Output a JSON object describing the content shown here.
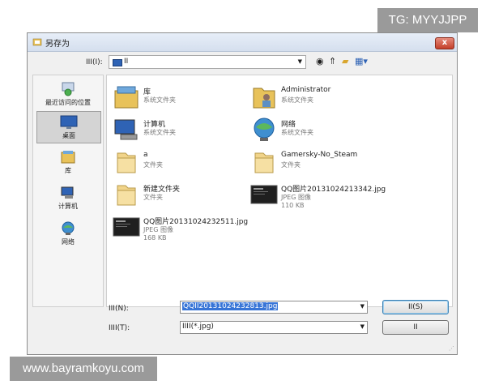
{
  "watermarks": {
    "top": "TG: MYYJJPP",
    "bottom": "www.bayramkoyu.com"
  },
  "window": {
    "title": "另存为",
    "close_glyph": "x"
  },
  "address": {
    "label": "III(I):",
    "value": "II"
  },
  "sidebar": {
    "items": [
      {
        "label": "最近访问的位置",
        "icon": "recent-places-icon"
      },
      {
        "label": "桌面",
        "icon": "desktop-icon",
        "selected": true
      },
      {
        "label": "库",
        "icon": "libraries-icon"
      },
      {
        "label": "计算机",
        "icon": "computer-icon"
      },
      {
        "label": "网络",
        "icon": "network-icon"
      }
    ]
  },
  "files": [
    {
      "name": "库",
      "type": "系统文件夹",
      "icon": "libraries-icon"
    },
    {
      "name": "Administrator",
      "type": "系统文件夹",
      "icon": "user-folder-icon"
    },
    {
      "name": "计算机",
      "type": "系统文件夹",
      "icon": "computer-icon"
    },
    {
      "name": "网络",
      "type": "系统文件夹",
      "icon": "network-icon"
    },
    {
      "name": "a",
      "type": "文件夹",
      "icon": "folder-icon"
    },
    {
      "name": "Gamersky-No_Steam",
      "type": "文件夹",
      "icon": "folder-icon"
    },
    {
      "name": "新建文件夹",
      "type": "文件夹",
      "icon": "folder-icon"
    },
    {
      "name": "QQ图片20131024213342.jpg",
      "type": "JPEG 图像",
      "size": "110 KB",
      "icon": "image-thumbnail-icon"
    },
    {
      "name": "QQ图片20131024232511.jpg",
      "type": "JPEG 图像",
      "size": "168 KB",
      "icon": "image-thumbnail-icon"
    }
  ],
  "filename": {
    "label": "III(N):",
    "value": "QQII20131024232813.jpg"
  },
  "filetype": {
    "label": "IIII(T):",
    "value": "IIII(*.jpg)"
  },
  "buttons": {
    "save": "II(S)",
    "cancel": "II"
  },
  "colors": {
    "accent": "#3875d7",
    "title_bg": "#dce6f4",
    "close": "#c4402a"
  }
}
